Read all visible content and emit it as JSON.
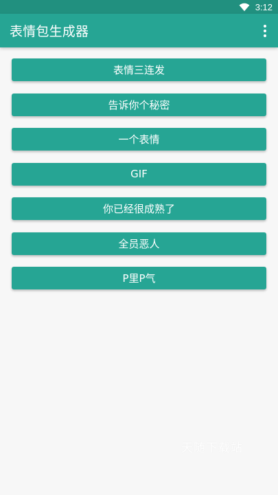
{
  "status_bar": {
    "time": "3:12",
    "wifi_icon": "wifi-icon"
  },
  "app_bar": {
    "title": "表情包生成器",
    "menu_icon": "more-vertical-icon"
  },
  "buttons": [
    {
      "label": "表情三连发"
    },
    {
      "label": "告诉你个秘密"
    },
    {
      "label": "一个表情"
    },
    {
      "label": "GIF"
    },
    {
      "label": "你已经很成熟了"
    },
    {
      "label": "全员恶人"
    },
    {
      "label": "P里P气"
    }
  ],
  "watermark": {
    "text": "天随下载站"
  },
  "colors": {
    "status_bar": "#21907f",
    "primary": "#26a594",
    "background": "#f7f7f7",
    "text_on_primary": "#ffffff"
  }
}
